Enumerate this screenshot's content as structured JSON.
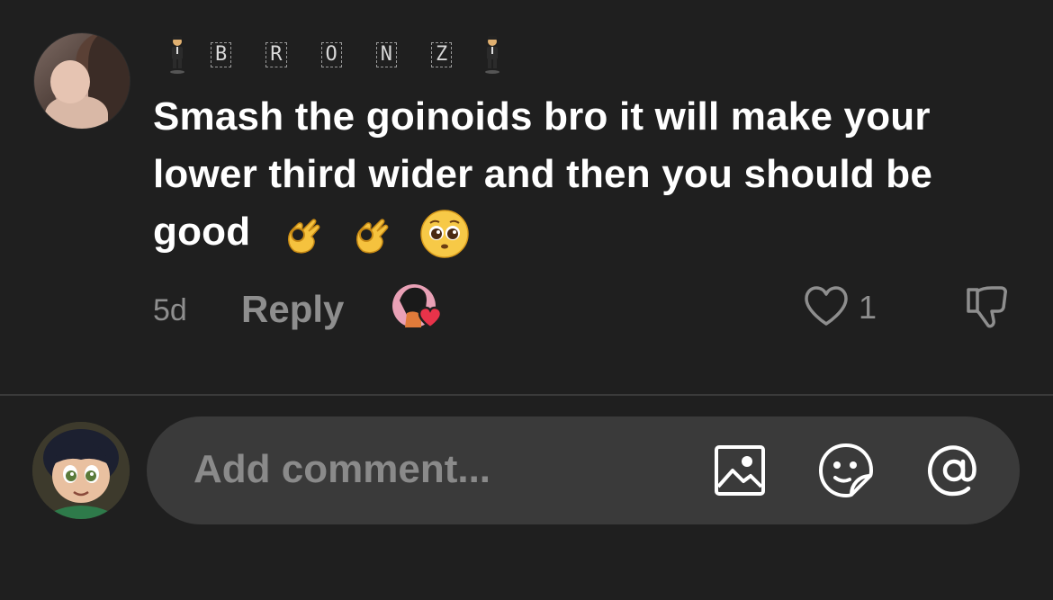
{
  "comment": {
    "username_letters": [
      "B",
      "R",
      "O",
      "N",
      "Z"
    ],
    "text": "Smash the goinoids bro it will make your lower third wider and then you should be good",
    "emojis": [
      "ok-hand-emoji",
      "ok-hand-emoji",
      "pleading-face-emoji"
    ],
    "timestamp": "5d",
    "reply_label": "Reply",
    "like_count": "1"
  },
  "composer": {
    "placeholder": "Add comment..."
  },
  "colors": {
    "background": "#1f1f1f",
    "muted_text": "#8e8e8e",
    "input_bg": "#3a3a3a",
    "heart_red": "#e8334a"
  }
}
